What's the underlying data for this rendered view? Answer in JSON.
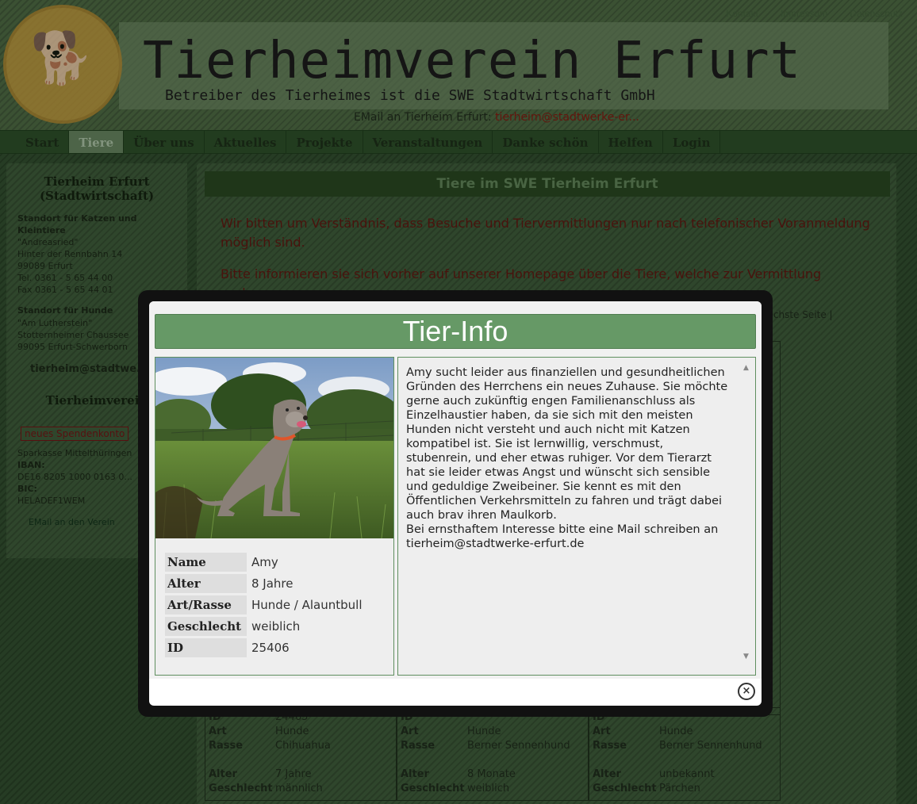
{
  "site": {
    "top_links": [
      "Kontakt",
      "Impressum",
      "Datenschutz"
    ],
    "title": "Tierheimverein Erfurt",
    "subtitle": "Betreiber des Tierheimes ist die SWE Stadtwirtschaft GmbH",
    "mail_label": "EMail an Tierheim Erfurt:",
    "mail_address": "tierheim@stadtwerke-er...",
    "logo_glyph": "🐕"
  },
  "nav": {
    "items": [
      "Start",
      "Tiere",
      "Über uns",
      "Aktuelles",
      "Projekte",
      "Veranstaltungen",
      "Danke schön",
      "Helfen",
      "Login"
    ],
    "active_index": 1
  },
  "sidebar": {
    "title1": "Tierheim Erfurt (Stadtwirtschaft)",
    "cats_heading": "Standort für Katzen und Kleintiere",
    "cats_address": "\"Andreasried\"\nHinter der Rennbahn 14\n99089 Erfurt\nTel. 0361 - 5 65 44 00\nFax 0361 - 5 65 44 01",
    "dogs_heading": "Standort für Hunde",
    "dogs_address": "\"Am Lutherstein\"\nStotternheimer Chaussee\n99095 Erfurt-Schwerborn",
    "mail": "tierheim@stadtwe...",
    "title2": "Tierheimverein",
    "badge": "neues Spendenkonto",
    "bank": "Sparkasse Mittelthüringen",
    "iban_label": "IBAN:",
    "iban": "DE16 8205 1000 0163 0...",
    "bic_label": "BIC:",
    "bic": "HELADEF1WEM",
    "mail_club": "EMail an den Verein"
  },
  "main": {
    "title": "Tiere im SWE Tierheim Erfurt",
    "notice1": "Wir bitten um Verständnis, dass Besuche und Tiervermittlungen nur nach telefonischer Voranmeldung möglich sind.",
    "notice2": "Bitte informieren sie sich vorher auf unserer Homepage über die Tiere, welche zur Vermittlung suchen.",
    "pager": "nächste Seite |",
    "cards": [
      {
        "id": "24465",
        "art": "Hunde",
        "rasse": "Chihuahua",
        "alter": "7 Jahre",
        "geschlecht": "männlich"
      },
      {
        "id": "",
        "art": "Hunde",
        "rasse": "Berner Sennenhund",
        "alter": "8 Monate",
        "geschlecht": "weiblich"
      },
      {
        "id": "",
        "art": "Hunde",
        "rasse": "Berner Sennenhund",
        "alter": "unbekannt",
        "geschlecht": "Pärchen"
      }
    ],
    "card_labels": {
      "id": "ID",
      "art": "Art",
      "rasse": "Rasse",
      "alter": "Alter",
      "geschlecht": "Geschlecht"
    }
  },
  "modal": {
    "title": "Tier-Info",
    "fields": [
      {
        "label": "Name",
        "value": "Amy"
      },
      {
        "label": "Alter",
        "value": "8 Jahre"
      },
      {
        "label": "Art/Rasse",
        "value": "Hunde / Alauntbull"
      },
      {
        "label": "Geschlecht",
        "value": "weiblich"
      },
      {
        "label": "ID",
        "value": "25406"
      }
    ],
    "description": "Amy sucht leider aus finanziellen und gesundheitlichen Gründen des Herrchens ein neues Zuhause. Sie möchte gerne auch zukünftig engen Familienanschluss als Einzelhaustier haben, da sie sich mit den meisten Hunden nicht versteht und auch nicht mit Katzen kompatibel ist. Sie ist lernwillig, verschmust, stubenrein, und eher etwas ruhiger. Vor dem Tierarzt hat sie leider etwas Angst und wünscht sich sensible und geduldige Zweibeiner. Sie kennt es mit den Öffentlichen Verkehrsmitteln zu fahren und trägt dabei auch brav ihren Maulkorb.\nBei ernsthaftem Interesse bitte eine Mail schreiben an tierheim@stadtwerke-erfurt.de",
    "close_glyph": "×",
    "scroll_up_glyph": "▲",
    "scroll_down_glyph": "▼"
  },
  "colors": {
    "header_green": "#669966",
    "panel_border": "#5f8f5f"
  }
}
